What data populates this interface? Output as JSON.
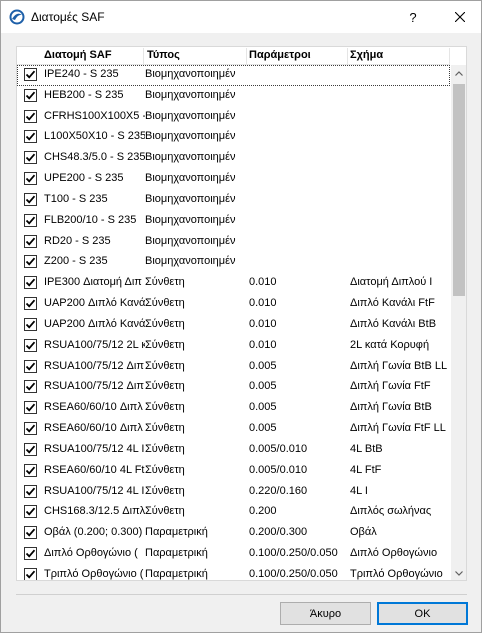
{
  "window": {
    "title": "Διατομές SAF",
    "help_label": "?"
  },
  "columns": [
    "Διατομή SAF",
    "Τύπος",
    "Παράμετροι",
    "Σχήμα"
  ],
  "rows": [
    {
      "name": "IPE240 - S 235",
      "type": "Βιομηχανοποιημέν",
      "params": "",
      "shape": "",
      "checked": true,
      "selected": true
    },
    {
      "name": "HEB200 - S 235",
      "type": "Βιομηχανοποιημέν",
      "params": "",
      "shape": "",
      "checked": true
    },
    {
      "name": "CFRHS100X100X5 -",
      "type": "Βιομηχανοποιημέν",
      "params": "",
      "shape": "",
      "checked": true
    },
    {
      "name": "L100X50X10 - S 235",
      "type": "Βιομηχανοποιημέν",
      "params": "",
      "shape": "",
      "checked": true
    },
    {
      "name": "CHS48.3/5.0 - S 235",
      "type": "Βιομηχανοποιημέν",
      "params": "",
      "shape": "",
      "checked": true
    },
    {
      "name": "UPE200 - S 235",
      "type": "Βιομηχανοποιημέν",
      "params": "",
      "shape": "",
      "checked": true
    },
    {
      "name": "T100 - S 235",
      "type": "Βιομηχανοποιημέν",
      "params": "",
      "shape": "",
      "checked": true
    },
    {
      "name": "FLB200/10 - S 235",
      "type": "Βιομηχανοποιημέν",
      "params": "",
      "shape": "",
      "checked": true
    },
    {
      "name": "RD20 - S 235",
      "type": "Βιομηχανοποιημέν",
      "params": "",
      "shape": "",
      "checked": true
    },
    {
      "name": "Z200 - S 235",
      "type": "Βιομηχανοποιημέν",
      "params": "",
      "shape": "",
      "checked": true
    },
    {
      "name": "IPE300 Διατομή Διπ",
      "type": "Σύνθετη",
      "params": "0.010",
      "shape": "Διατομή Διπλού Ι",
      "checked": true
    },
    {
      "name": "UAP200 Διπλό Κανά",
      "type": "Σύνθετη",
      "params": "0.010",
      "shape": "Διπλό Κανάλι FtF",
      "checked": true
    },
    {
      "name": "UAP200 Διπλό Κανά",
      "type": "Σύνθετη",
      "params": "0.010",
      "shape": "Διπλό Κανάλι BtB",
      "checked": true
    },
    {
      "name": "RSUA100/75/12 2L κ",
      "type": "Σύνθετη",
      "params": "0.010",
      "shape": "2L κατά Κορυφή",
      "checked": true
    },
    {
      "name": "RSUA100/75/12 Διπ",
      "type": "Σύνθετη",
      "params": "0.005",
      "shape": "Διπλή Γωνία BtB LL",
      "checked": true
    },
    {
      "name": "RSUA100/75/12 Διπ",
      "type": "Σύνθετη",
      "params": "0.005",
      "shape": "Διπλή Γωνία FtF",
      "checked": true
    },
    {
      "name": "RSEA60/60/10 Διπλ",
      "type": "Σύνθετη",
      "params": "0.005",
      "shape": "Διπλή Γωνία BtB",
      "checked": true
    },
    {
      "name": "RSEA60/60/10 Διπλ",
      "type": "Σύνθετη",
      "params": "0.005",
      "shape": "Διπλή Γωνία FtF LL",
      "checked": true
    },
    {
      "name": "RSUA100/75/12 4L I",
      "type": "Σύνθετη",
      "params": "0.005/0.010",
      "shape": "4L BtB",
      "checked": true
    },
    {
      "name": "RSEA60/60/10 4L Ft",
      "type": "Σύνθετη",
      "params": "0.005/0.010",
      "shape": "4L FtF",
      "checked": true
    },
    {
      "name": "RSUA100/75/12 4L I",
      "type": "Σύνθετη",
      "params": "0.220/0.160",
      "shape": "4L I",
      "checked": true
    },
    {
      "name": "CHS168.3/12.5 Διπλ",
      "type": "Σύνθετη",
      "params": "0.200",
      "shape": "Διπλός σωλήνας",
      "checked": true
    },
    {
      "name": "Οβάλ (0.200; 0.300)",
      "type": "Παραμετρική",
      "params": "0.200/0.300",
      "shape": "Οβάλ",
      "checked": true
    },
    {
      "name": "Διπλό Ορθογώνιο (",
      "type": "Παραμετρική",
      "params": "0.100/0.250/0.050",
      "shape": "Διπλό Ορθογώνιο",
      "checked": true
    },
    {
      "name": "Τριπλό Ορθογώνιο (",
      "type": "Παραμετρική",
      "params": "0.100/0.250/0.050",
      "shape": "Τριπλό Ορθογώνιο",
      "checked": true
    }
  ],
  "buttons": {
    "cancel": "Άκυρο",
    "ok": "OK"
  },
  "colors": {
    "accent": "#0078d7",
    "check": "#000000",
    "scroll_thumb": "#c2c2c2"
  },
  "icons": {
    "app": "circle-logo-icon",
    "close": "close-icon",
    "scroll_up": "chevron-up-icon",
    "scroll_down": "chevron-down-icon",
    "checkbox": "checkmark-icon"
  }
}
